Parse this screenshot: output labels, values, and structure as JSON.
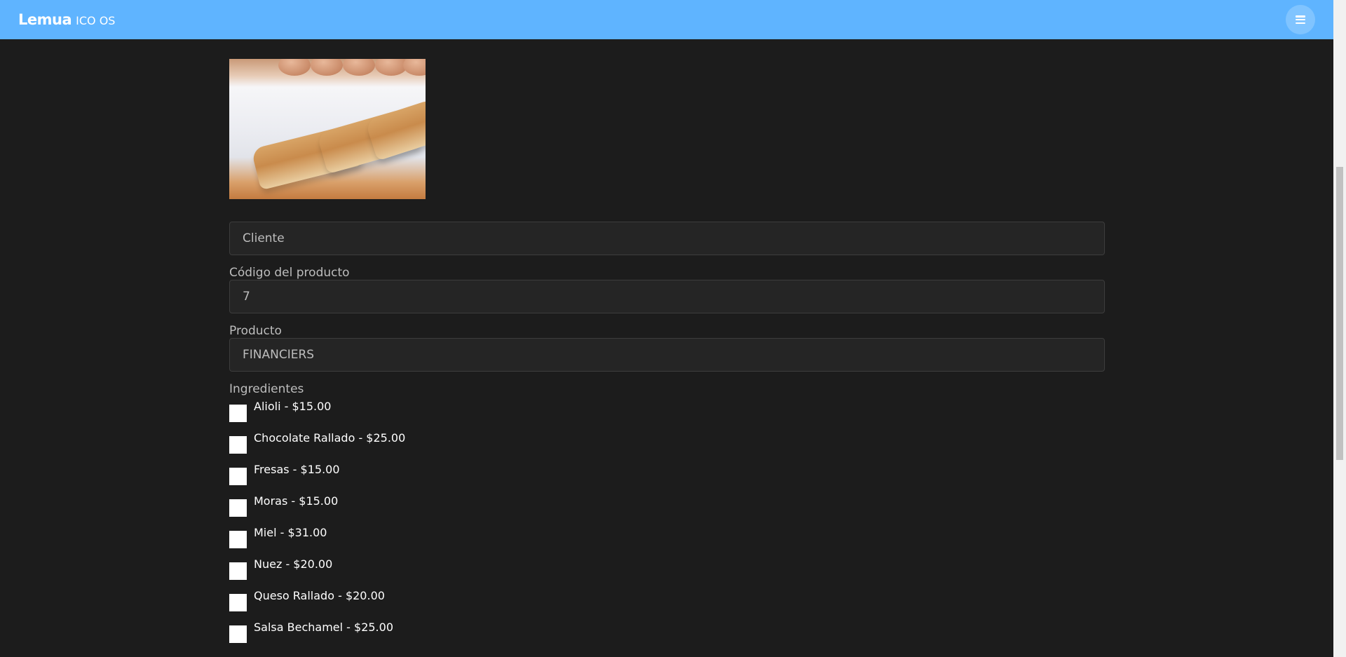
{
  "navbar": {
    "brand_name": "Lemua",
    "brand_sub": "ICO OS",
    "menu_icon": "hamburger-icon",
    "color": "#5fb4ff"
  },
  "product_image": {
    "alt": "FINANCIERS"
  },
  "form": {
    "cliente_placeholder": "Cliente",
    "codigo_label": "Código del producto",
    "codigo_value": "7",
    "producto_label": "Producto",
    "producto_value": "FINANCIERS",
    "ingredientes_label": "Ingredientes",
    "ingredientes": [
      {
        "label": "Alioli - $15.00",
        "checked": false
      },
      {
        "label": "Chocolate Rallado - $25.00",
        "checked": false
      },
      {
        "label": "Fresas - $15.00",
        "checked": false
      },
      {
        "label": "Moras - $15.00",
        "checked": false
      },
      {
        "label": "Miel - $31.00",
        "checked": false
      },
      {
        "label": "Nuez - $20.00",
        "checked": false
      },
      {
        "label": "Queso Rallado - $20.00",
        "checked": false
      },
      {
        "label": "Salsa Bechamel - $25.00",
        "checked": false
      }
    ]
  }
}
